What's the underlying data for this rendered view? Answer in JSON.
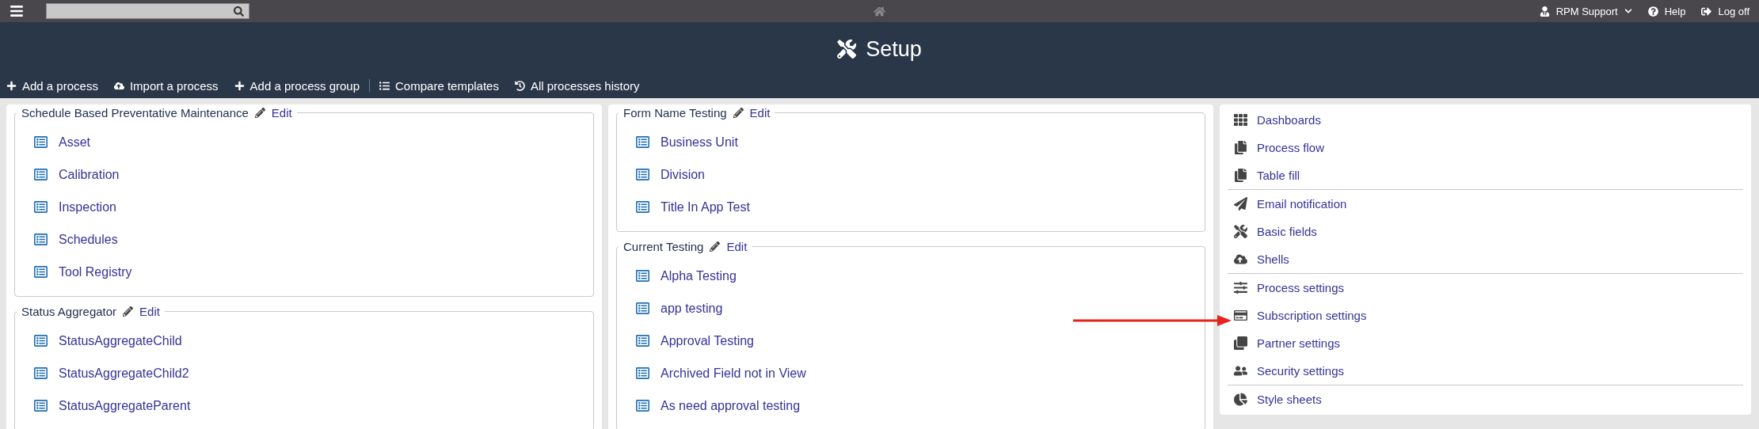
{
  "top_bar": {
    "user_menu": "RPM Support",
    "help": "Help",
    "log_off": "Log off"
  },
  "header": {
    "title": "Setup"
  },
  "toolbar": [
    [
      {
        "label": "Add a process"
      },
      {
        "label": "Import a process"
      },
      {
        "label": "Add a process group"
      }
    ],
    [
      {
        "label": "Compare templates"
      },
      {
        "label": "All processes history"
      }
    ]
  ],
  "process_columns": [
    [
      {
        "title": "Schedule Based Preventative Maintenance",
        "edit": "Edit",
        "items": [
          "Asset",
          "Calibration",
          "Inspection",
          "Schedules",
          "Tool Registry"
        ]
      },
      {
        "title": "Status Aggregator",
        "edit": "Edit",
        "items": [
          "StatusAggregateChild",
          "StatusAggregateChild2",
          "StatusAggregateParent"
        ]
      }
    ],
    [
      {
        "title": "Form Name Testing",
        "edit": "Edit",
        "items": [
          "Business Unit",
          "Division",
          "Title In App Test"
        ]
      },
      {
        "title": "Current Testing",
        "edit": "Edit",
        "items": [
          "Alpha Testing",
          "app testing",
          "Approval Testing",
          "Archived Field not in View",
          "As need approval testing"
        ]
      }
    ]
  ],
  "settings_menu": [
    [
      "Dashboards",
      "Process flow",
      "Table fill"
    ],
    [
      "Email notification",
      "Basic fields",
      "Shells"
    ],
    [
      "Process settings",
      "Subscription settings",
      "Partner settings",
      "Security settings"
    ],
    [
      "Style sheets"
    ]
  ]
}
